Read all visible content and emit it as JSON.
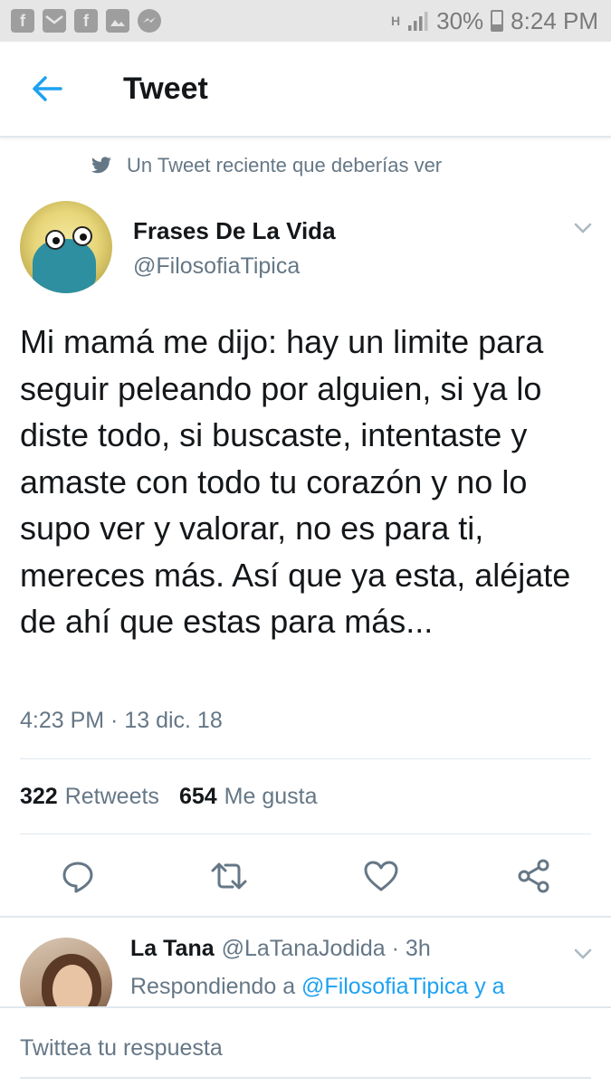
{
  "status_bar": {
    "notifications": [
      "facebook-icon",
      "mail-icon",
      "facebook-icon",
      "image-icon",
      "messenger-icon"
    ],
    "network": "H",
    "battery": "30%",
    "time": "8:24 PM"
  },
  "header": {
    "title": "Tweet"
  },
  "recent_label": "Un Tweet reciente que deberías ver",
  "tweet": {
    "author_name": "Frases De La Vida",
    "author_handle": "@FilosofiaTipica",
    "text": "Mi mamá me dijo: hay un limite para seguir peleando por alguien, si ya lo diste todo, si buscaste, intentaste y amaste con todo tu corazón y no lo supo ver y valorar, no es para ti, mereces más. Así que ya esta, aléjate de ahí que estas para más...",
    "timestamp": "4:23 PM · 13 dic. 18",
    "retweets_count": "322",
    "retweets_label": "Retweets",
    "likes_count": "654",
    "likes_label": "Me gusta"
  },
  "reply": {
    "name": "La Tana",
    "handle_time": "@LaTanaJodida · 3h",
    "replying_prefix": "Respondiendo a",
    "replying_to": "@FilosofiaTipica y a"
  },
  "compose": {
    "placeholder": "Twittea tu respuesta"
  },
  "colors": {
    "accent": "#1da1f2",
    "secondary_text": "#657786",
    "divider": "#e1e8ed"
  }
}
